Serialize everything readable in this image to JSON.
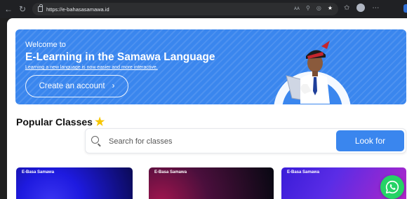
{
  "browser": {
    "url": "https://e-bahasasamawa.id",
    "icons": [
      "back-icon",
      "refresh-icon",
      "lock-icon",
      "read-aloud-icon",
      "zoom-icon",
      "extensions-icon",
      "favorite-star-icon",
      "favorites-icon",
      "profile-avatar",
      "more-icon"
    ]
  },
  "hero": {
    "welcome": "Welcome to",
    "title": "E-Learning in the Samawa Language",
    "subtitle": "Learning a new language is now easier and more interactive.",
    "cta_label": "Create an account",
    "cta_icon": "chevron-right-icon"
  },
  "popular": {
    "title": "Popular Classes",
    "icon": "star-icon"
  },
  "search": {
    "placeholder": "Search for classes",
    "value": "",
    "button_label": "Look for"
  },
  "cards": [
    {
      "label": "E-Basa Samawa"
    },
    {
      "label": "E-Basa Samawa"
    },
    {
      "label": "E-Basa Samawa"
    }
  ],
  "fab": {
    "icon": "whatsapp-icon"
  },
  "colors": {
    "primary": "#3a86ee",
    "star": "#f7c600",
    "whatsapp": "#25d366",
    "chrome": "#202124"
  }
}
